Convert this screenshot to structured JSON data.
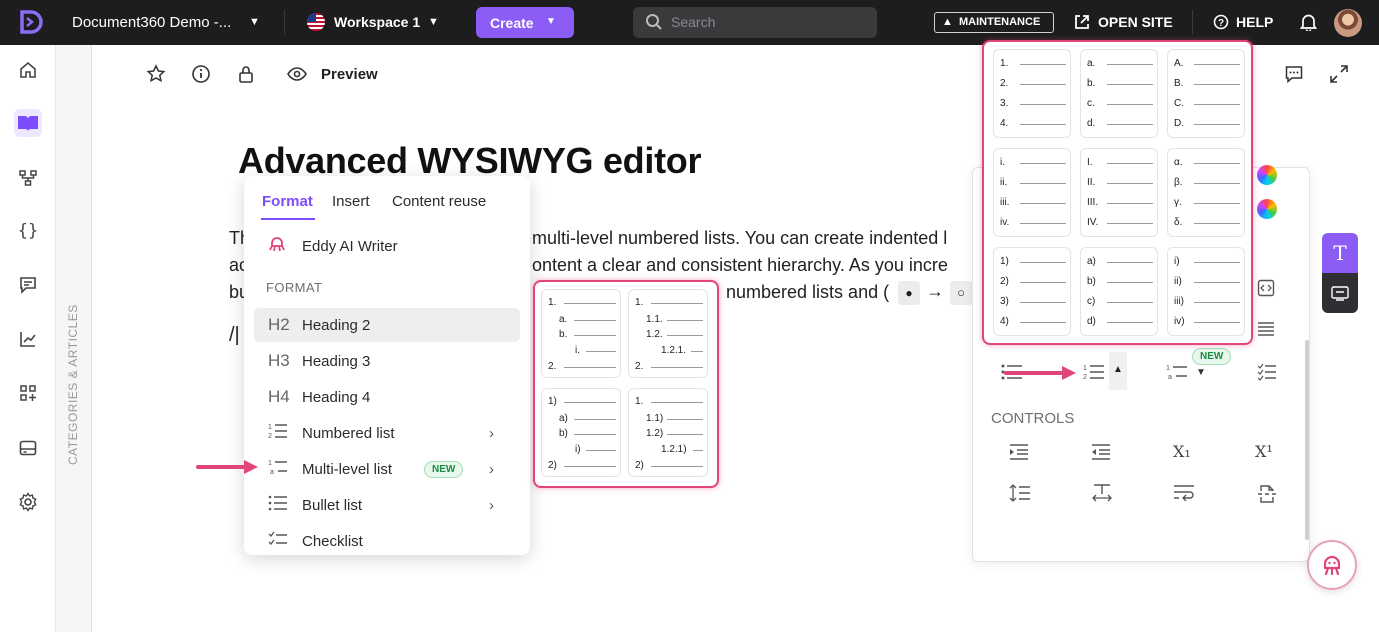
{
  "topbar": {
    "project": "Document360 Demo -...",
    "workspace": "Workspace 1",
    "create": "Create",
    "search_placeholder": "Search",
    "maintenance": "MAINTENANCE",
    "open_site": "OPEN SITE",
    "help": "HELP"
  },
  "toolbar": {
    "preview": "Preview"
  },
  "sidebar": {
    "categories_label": "CATEGORIES & ARTICLES"
  },
  "article": {
    "title": "Advanced WYSIWYG editor",
    "line1a": "Th",
    "line1b": "multi-level numbered lists. You can create indented l",
    "line2a": "ac",
    "line2b": "ontent a clear and consistent hierarchy. As you incre",
    "line3a": "bu",
    "line3b": "numbered lists and (",
    "arrow": "→",
    "cursor": "/|"
  },
  "format_menu": {
    "tabs": [
      "Format",
      "Insert",
      "Content reuse"
    ],
    "eddy": "Eddy AI Writer",
    "section": "FORMAT",
    "items": [
      {
        "icon": "H2",
        "label": "Heading 2"
      },
      {
        "icon": "H3",
        "label": "Heading 3"
      },
      {
        "icon": "H4",
        "label": "Heading 4"
      },
      {
        "label": "Numbered list"
      },
      {
        "label": "Multi-level list",
        "badge": "NEW"
      },
      {
        "label": "Bullet list"
      },
      {
        "label": "Checklist"
      }
    ]
  },
  "multilevel_popup": {
    "tiles": [
      {
        "labels": [
          "1.",
          "a.",
          "b.",
          "i.",
          "2."
        ]
      },
      {
        "labels": [
          "1.",
          "1.1.",
          "1.2.",
          "1.2.1.",
          "2."
        ]
      },
      {
        "labels": [
          "1)",
          "a)",
          "b)",
          "i)",
          "2)"
        ]
      },
      {
        "labels": [
          "1.",
          "1.1)",
          "1.2)",
          "1.2.1)",
          "2)"
        ]
      }
    ]
  },
  "numbered_popup": {
    "tiles": [
      {
        "labels": [
          "1.",
          "2.",
          "3.",
          "4."
        ]
      },
      {
        "labels": [
          "a.",
          "b.",
          "c.",
          "d."
        ]
      },
      {
        "labels": [
          "A.",
          "B.",
          "C.",
          "D."
        ]
      },
      {
        "labels": [
          "i.",
          "ii.",
          "iii.",
          "iv."
        ]
      },
      {
        "labels": [
          "I.",
          "II.",
          "III.",
          "IV."
        ]
      },
      {
        "labels": [
          "α.",
          "β.",
          "γ.",
          "δ."
        ]
      },
      {
        "labels": [
          "1)",
          "2)",
          "3)",
          "4)"
        ]
      },
      {
        "labels": [
          "a)",
          "b)",
          "c)",
          "d)"
        ]
      },
      {
        "labels": [
          "i)",
          "ii)",
          "iii)",
          "iv)"
        ]
      }
    ]
  },
  "side_panel": {
    "new_badge": "NEW",
    "controls": "CONTROLS",
    "subscript": "X₁",
    "superscript": "X¹"
  },
  "colors": {
    "accent": "#7c4dff",
    "highlight": "#e0457b",
    "topbar": "#1d1d1f"
  }
}
